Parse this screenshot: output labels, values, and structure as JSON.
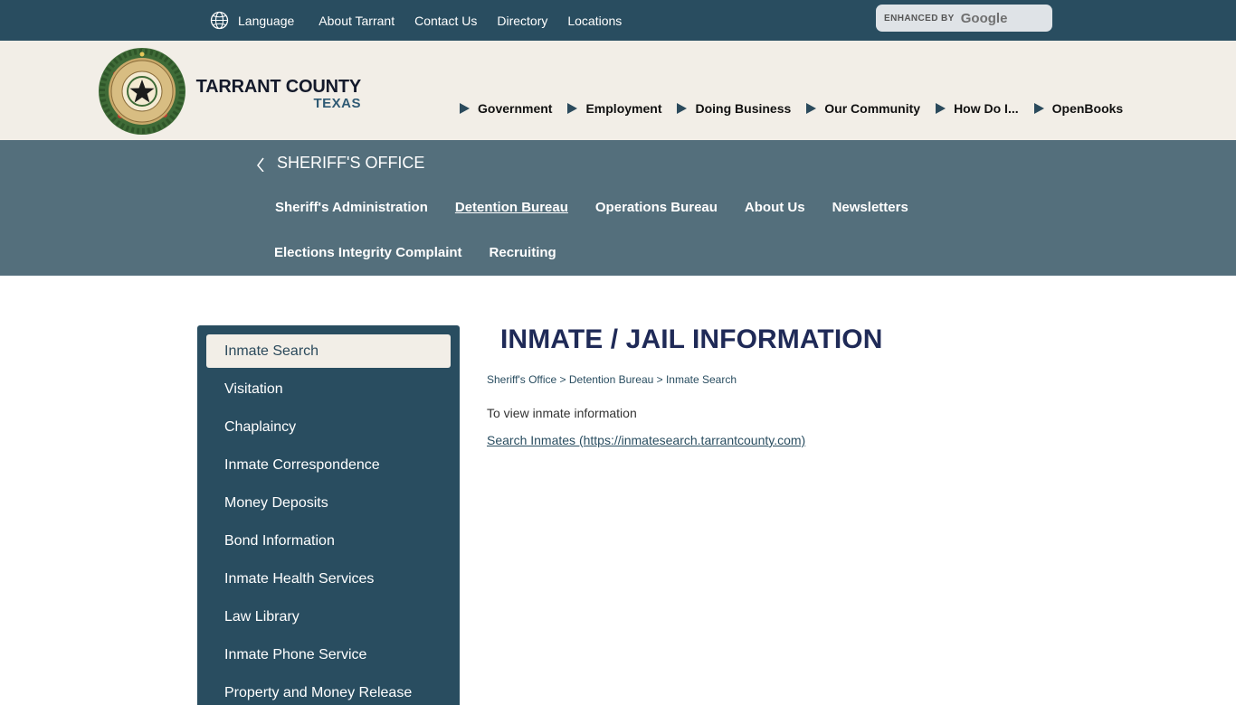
{
  "topbar": {
    "language_label": "Language",
    "links": [
      "About Tarrant",
      "Contact Us",
      "Directory",
      "Locations"
    ],
    "search": {
      "enhanced_by": "ENHANCED BY",
      "google": "Google"
    }
  },
  "header": {
    "county": "TARRANT COUNTY",
    "state": "TEXAS",
    "nav": [
      "Government",
      "Employment",
      "Doing Business",
      "Our Community",
      "How Do I...",
      "OpenBooks"
    ]
  },
  "department": {
    "title": "SHERIFF'S OFFICE",
    "nav_row1": [
      "Sheriff's Administration",
      "Detention Bureau",
      "Operations Bureau",
      "About Us",
      "Newsletters"
    ],
    "nav_row2": [
      "Elections Integrity Complaint",
      "Recruiting"
    ],
    "active_nav": "Detention Bureau"
  },
  "sidebar": {
    "items": [
      "Inmate Search",
      "Visitation",
      "Chaplaincy",
      "Inmate Correspondence",
      "Money Deposits",
      "Bond Information",
      "Inmate Health Services",
      "Law Library",
      "Inmate Phone Service",
      "Property and Money Release"
    ],
    "active": "Inmate Search"
  },
  "content": {
    "title": "INMATE / JAIL INFORMATION",
    "breadcrumb": "Sheriff's Office > Detention Bureau > Inmate Search",
    "intro": "To view inmate information",
    "link_text": "Search Inmates (https://inmatesearch.tarrantcounty.com)"
  },
  "colors": {
    "topbar": "#294d60",
    "header_bg": "#f2eee7",
    "band": "#546f7c",
    "sidebar": "#294d60",
    "title": "#1f2a57"
  },
  "icons": {
    "language": "globe-icon",
    "back": "chevron-left-icon",
    "nav_marker": "triangle-right-icon",
    "seal": "county-seal-logo"
  }
}
